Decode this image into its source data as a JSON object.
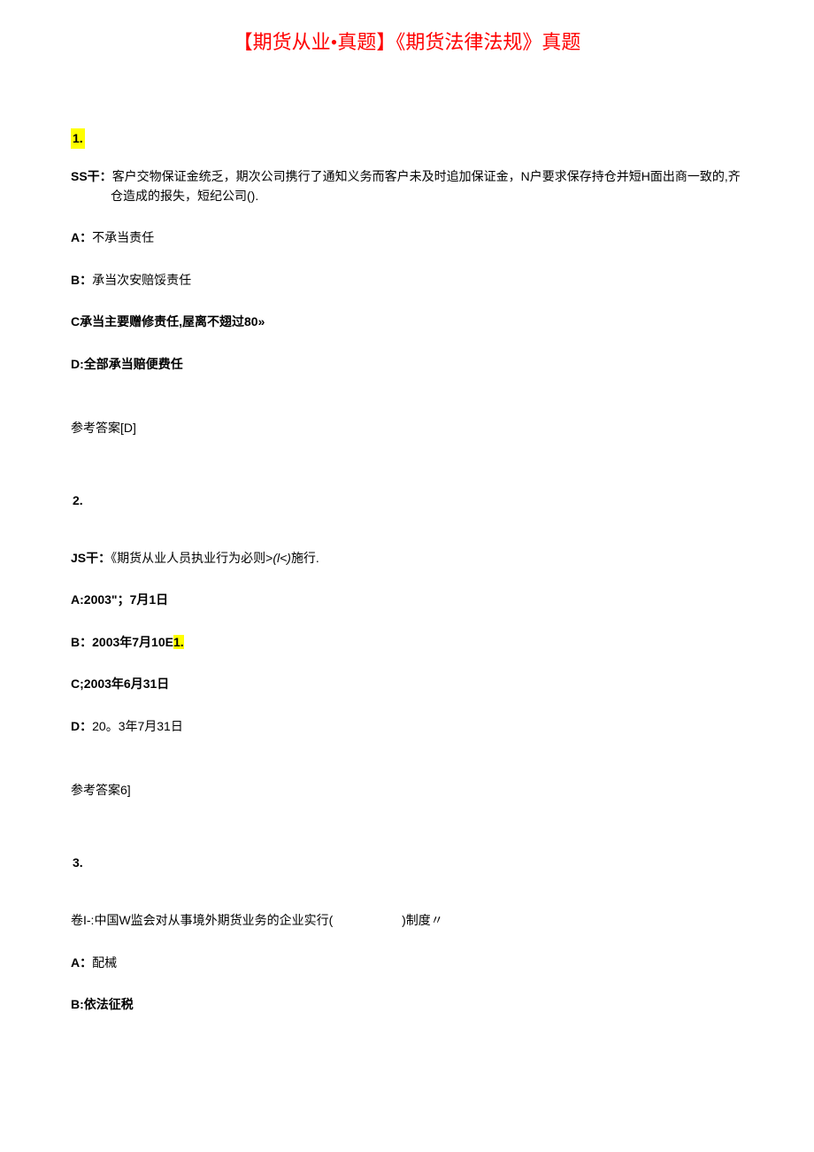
{
  "title": "【期货从业•真题】《期货法律法规》真题",
  "questions": [
    {
      "number": "1.",
      "number_highlighted": true,
      "stem_prefix": "SS干：",
      "stem": "客户交物保证金统乏，期次公司携行了通知义务而客户未及时追加保证金，N户要求保存持仓并短H面出商一致的,齐仓造成的报失，短纪公司().",
      "options": [
        {
          "label": "A：",
          "text": "不承当责任",
          "bold_label": true
        },
        {
          "label": "B：",
          "text": "承当次安赔馁责任",
          "bold_label": true
        },
        {
          "label": "C",
          "text": "承当主要赠修责任,屋离不翅过80»",
          "bold_all": true
        },
        {
          "label": "D:",
          "text": "全部承当赔便费任",
          "bold_all": true
        }
      ],
      "answer": "参考答案[D]"
    },
    {
      "number": "2.",
      "number_highlighted": false,
      "stem_prefix": "JS干：",
      "stem_pre": "《期货从业人员执业行为必则>",
      "stem_italic": "(l<)",
      "stem_post": "施行.",
      "options": [
        {
          "label": "A:",
          "text": "2003\"；7月1日",
          "bold_all": true
        },
        {
          "label": "B：",
          "text_pre": "2003年7月10E",
          "highlight": "1.",
          "bold_label": true,
          "bold_text": true
        },
        {
          "label": "C;",
          "text": "2003年6月31日",
          "bold_all": true
        },
        {
          "label": "D：",
          "text": "20。3年7月31日",
          "bold_label": true
        }
      ],
      "answer": "参考答案6]"
    },
    {
      "number": "3.",
      "number_highlighted": false,
      "stem_prefix": "卷I-:",
      "stem_pre": "中国W监会对从事境外期货业务的企业实行(",
      "fill_space": "                    ",
      "stem_post": ")制度〃",
      "options": [
        {
          "label": "A：",
          "text": "配械",
          "bold_label": true
        },
        {
          "label": "B:",
          "text": "依法征税",
          "bold_all": true
        }
      ]
    }
  ]
}
